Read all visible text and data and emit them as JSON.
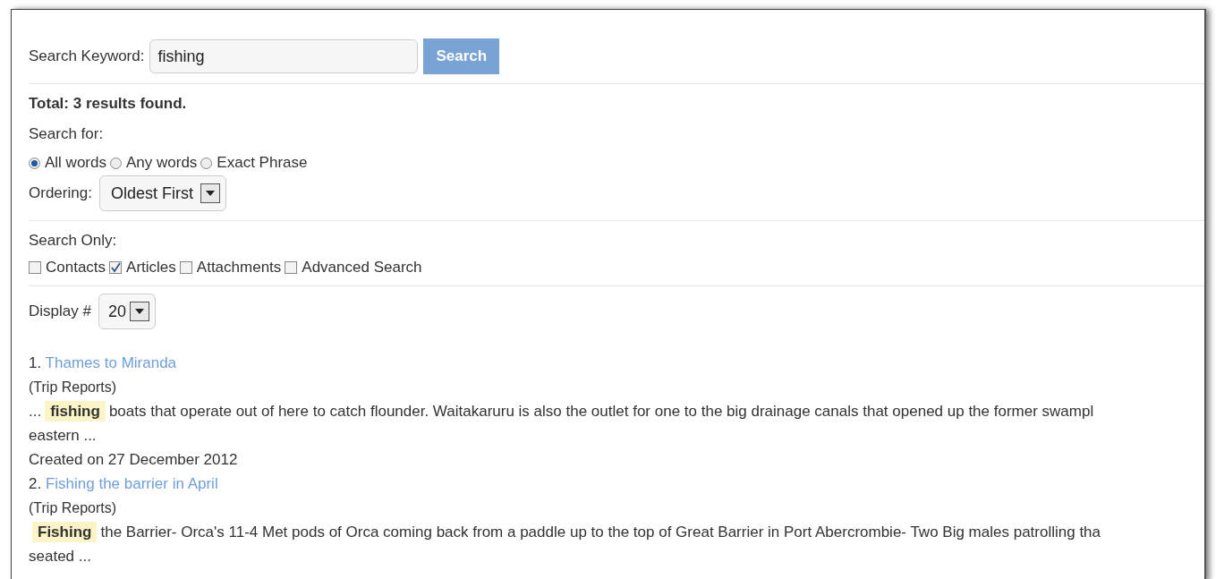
{
  "search": {
    "label": "Search Keyword:",
    "value": "fishing",
    "button": "Search"
  },
  "total": "Total: 3 results found.",
  "search_for": {
    "label": "Search for:",
    "options": [
      {
        "label": "All words",
        "selected": true
      },
      {
        "label": "Any words",
        "selected": false
      },
      {
        "label": "Exact Phrase",
        "selected": false
      }
    ]
  },
  "ordering": {
    "label": "Ordering:",
    "value": "Oldest First"
  },
  "search_only": {
    "label": "Search Only:",
    "options": [
      {
        "label": "Contacts",
        "checked": false
      },
      {
        "label": "Articles",
        "checked": true
      },
      {
        "label": "Attachments",
        "checked": false
      },
      {
        "label": "Advanced Search",
        "checked": false
      }
    ]
  },
  "display": {
    "label": "Display #",
    "value": "20"
  },
  "results": [
    {
      "number": "1.",
      "title": "Thames to Miranda",
      "category": "(Trip Reports)",
      "before": "...",
      "match": "fishing",
      "after": "boats that operate out of here to catch flounder. Waitakaruru is also the outlet for one to the big drainage canals that opened up the former swampl",
      "next_line": "eastern ...",
      "created": "Created on 27 December 2012"
    },
    {
      "number": "2.",
      "title": "Fishing the barrier in April",
      "category": "(Trip Reports)",
      "match": "Fishing",
      "after": "the Barrier- Orca's 11-4 Met pods of Orca coming back from a paddle up to the top of Great Barrier in Port Abercrombie- Two Big males patrolling tha",
      "next_line": "seated ..."
    }
  ]
}
